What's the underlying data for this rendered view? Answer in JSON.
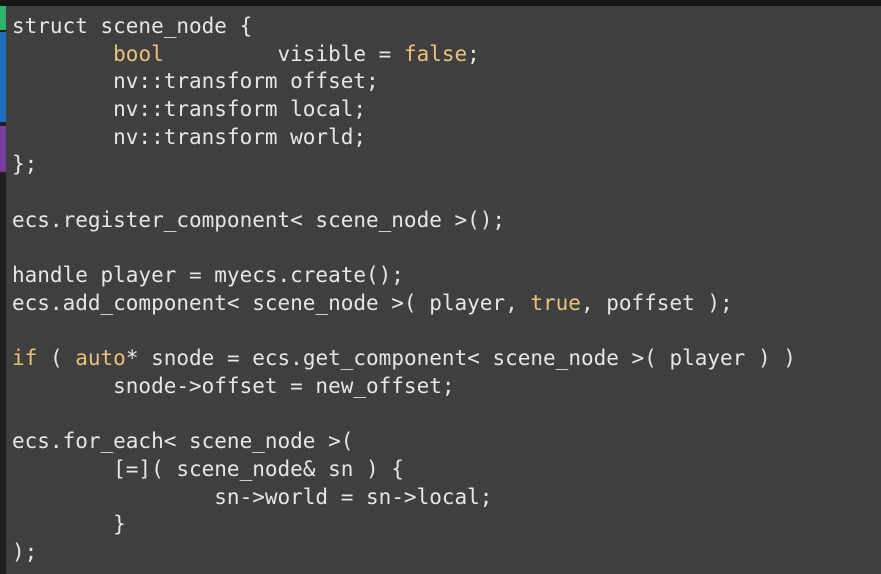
{
  "editor": {
    "language": "C++",
    "colors": {
      "background": "#3f3f3f",
      "text": "#e6e6e6",
      "keyword": "#e8c27a"
    },
    "lines": [
      [
        {
          "t": "struct scene_node {",
          "k": "text"
        }
      ],
      [
        {
          "t": "        ",
          "k": "text"
        },
        {
          "t": "bool",
          "k": "keyword"
        },
        {
          "t": "         visible = ",
          "k": "text"
        },
        {
          "t": "false",
          "k": "keyword"
        },
        {
          "t": ";",
          "k": "text"
        }
      ],
      [
        {
          "t": "        nv::transform offset;",
          "k": "text"
        }
      ],
      [
        {
          "t": "        nv::transform local;",
          "k": "text"
        }
      ],
      [
        {
          "t": "        nv::transform world;",
          "k": "text"
        }
      ],
      [
        {
          "t": "};",
          "k": "text"
        }
      ],
      [
        {
          "t": "",
          "k": "text"
        }
      ],
      [
        {
          "t": "ecs.register_component< scene_node >();",
          "k": "text"
        }
      ],
      [
        {
          "t": "",
          "k": "text"
        }
      ],
      [
        {
          "t": "handle player = myecs.create();",
          "k": "text"
        }
      ],
      [
        {
          "t": "ecs.add_component< scene_node >( player, ",
          "k": "text"
        },
        {
          "t": "true",
          "k": "keyword"
        },
        {
          "t": ", poffset );",
          "k": "text"
        }
      ],
      [
        {
          "t": "",
          "k": "text"
        }
      ],
      [
        {
          "t": "if",
          "k": "keyword"
        },
        {
          "t": " ( ",
          "k": "text"
        },
        {
          "t": "auto",
          "k": "keyword"
        },
        {
          "t": "* snode = ecs.get_component< scene_node >( player ) )",
          "k": "text"
        }
      ],
      [
        {
          "t": "        snode->offset = new_offset;",
          "k": "text"
        }
      ],
      [
        {
          "t": "",
          "k": "text"
        }
      ],
      [
        {
          "t": "ecs.for_each< scene_node >(",
          "k": "text"
        }
      ],
      [
        {
          "t": "        [=]( scene_node& sn ) {",
          "k": "text"
        }
      ],
      [
        {
          "t": "                sn->world = sn->local;",
          "k": "text"
        }
      ],
      [
        {
          "t": "        }",
          "k": "text"
        }
      ],
      [
        {
          "t": ");",
          "k": "text"
        }
      ]
    ]
  }
}
